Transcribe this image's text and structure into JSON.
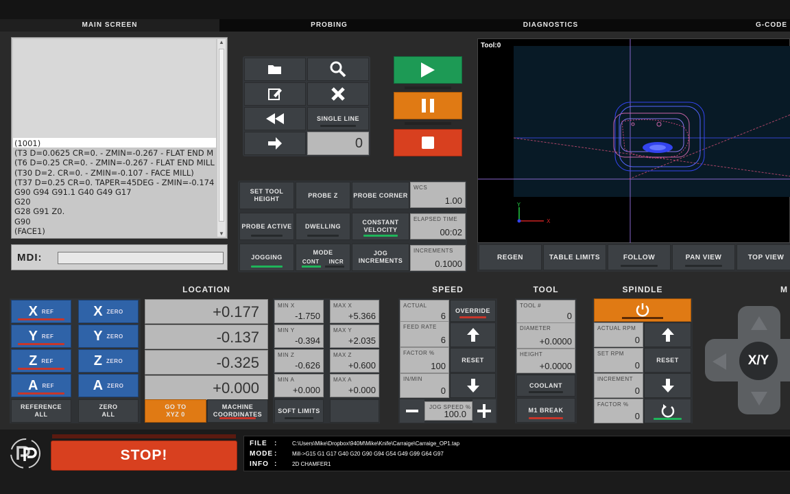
{
  "tabs": [
    "MAIN SCREEN",
    "PROBING",
    "DIAGNOSTICS",
    "G-CODE"
  ],
  "gcode_lines": [
    "(1001)",
    "(T3  D=0.0625 CR=0. - ZMIN=-0.267 - FLAT END M",
    "(T6  D=0.25 CR=0. - ZMIN=-0.267 - FLAT END MILL",
    "(T30  D=2. CR=0. - ZMIN=-0.107 - FACE MILL)",
    "(T37  D=0.25 CR=0. TAPER=45DEG - ZMIN=-0.174",
    "G90 G94 G91.1 G40 G49 G17",
    "G20",
    "G28 G91 Z0.",
    "G90",
    "(FACE1)"
  ],
  "mdi_label": "MDI:",
  "file_controls": {
    "single_line": "SINGLE LINE",
    "line_value": "0"
  },
  "probe_buttons": {
    "set_tool_height": [
      "SET TOOL",
      "HEIGHT"
    ],
    "probe_z": "PROBE Z",
    "probe_corner": "PROBE CORNER",
    "probe_active": "PROBE ACTIVE",
    "dwelling": "DWELLING",
    "constant_velocity": [
      "CONSTANT",
      "VELOCITY"
    ],
    "jogging": "JOGGING",
    "mode": "MODE",
    "mode_cont": "CONT",
    "mode_incr": "INCR",
    "jog_increments": [
      "JOG",
      "INCREMENTS"
    ]
  },
  "info_boxes": {
    "wcs": {
      "label": "WCS",
      "value": "1.00"
    },
    "elapsed": {
      "label": "ELAPSED TIME",
      "value": "00:02"
    },
    "increments": {
      "label": "INCREMENTS",
      "value": "0.1000"
    }
  },
  "viewer": {
    "tool_label": "Tool:0",
    "buttons": [
      "REGEN",
      "TABLE LIMITS",
      "FOLLOW",
      "PAN VIEW",
      "TOP VIEW"
    ]
  },
  "sections": {
    "location": "LOCATION",
    "speed": "SPEED",
    "tool": "TOOL",
    "spindle": "SPINDLE",
    "m": "M"
  },
  "axes": [
    {
      "axis": "X",
      "ref": "REF",
      "zero": "ZERO",
      "value": "+0.177",
      "min_label": "MIN X",
      "min": "-1.750",
      "max_label": "MAX X",
      "max": "+5.366"
    },
    {
      "axis": "Y",
      "ref": "REF",
      "zero": "ZERO",
      "value": "-0.137",
      "min_label": "MIN Y",
      "min": "-0.394",
      "max_label": "MAX Y",
      "max": "+2.035"
    },
    {
      "axis": "Z",
      "ref": "REF",
      "zero": "ZERO",
      "value": "-0.325",
      "min_label": "MIN Z",
      "min": "-0.626",
      "max_label": "MAX Z",
      "max": "+0.600"
    },
    {
      "axis": "A",
      "ref": "REF",
      "zero": "ZERO",
      "value": "+0.000",
      "min_label": "MIN A",
      "min": "+0.000",
      "max_label": "MAX A",
      "max": "+0.000"
    }
  ],
  "location_buttons": {
    "reference_all": [
      "REFERENCE",
      "ALL"
    ],
    "zero_all": [
      "ZERO",
      "ALL"
    ],
    "goto_xyz0": [
      "GO TO",
      "XYZ 0"
    ],
    "machine_coords": [
      "MACHINE",
      "COORDINATES"
    ],
    "soft_limits": "SOFT LIMITS"
  },
  "speed": {
    "actual": {
      "label": "ACTUAL",
      "value": "6"
    },
    "feed_rate": {
      "label": "FEED RATE",
      "value": "6"
    },
    "factor": {
      "label": "FACTOR %",
      "value": "100"
    },
    "in_min": {
      "label": "IN/MIN",
      "value": "0"
    },
    "override": "OVERRIDE",
    "reset": "RESET",
    "jog_speed": {
      "label": "JOG SPEED %",
      "value": "100.0"
    }
  },
  "tool": {
    "tool_num": {
      "label": "TOOL #",
      "value": "0"
    },
    "diameter": {
      "label": "DIAMETER",
      "value": "+0.0000"
    },
    "height": {
      "label": "HEIGHT",
      "value": "+0.0000"
    },
    "coolant": "COOLANT",
    "m1_break": "M1 BREAK"
  },
  "spindle": {
    "actual_rpm": {
      "label": "ACTUAL RPM",
      "value": "0"
    },
    "set_rpm": {
      "label": "SET RPM",
      "value": "0"
    },
    "increment": {
      "label": "INCREMENT",
      "value": "0"
    },
    "factor": {
      "label": "FACTOR %",
      "value": "0"
    },
    "reset": "RESET"
  },
  "jog_pad": {
    "center": "X/Y"
  },
  "stop_label": "STOP!",
  "status": {
    "file_key": "FILE",
    "file": "C:\\Users\\Mike\\Dropbox\\940M\\Mike\\Knife\\Carraige\\Carraige_OP1.tap",
    "mode_key": "MODE",
    "mode": "Mill->G15  G1 G17 G40 G20 G90 G94 G54 G49 G99 G64 G97",
    "info_key": "INFO",
    "info": "2D CHAMFER1",
    "sep": ":"
  },
  "colors": {
    "green": "#1d9a55",
    "orange": "#e07a14",
    "red": "#d8401f",
    "blue": "#2f63a8"
  }
}
